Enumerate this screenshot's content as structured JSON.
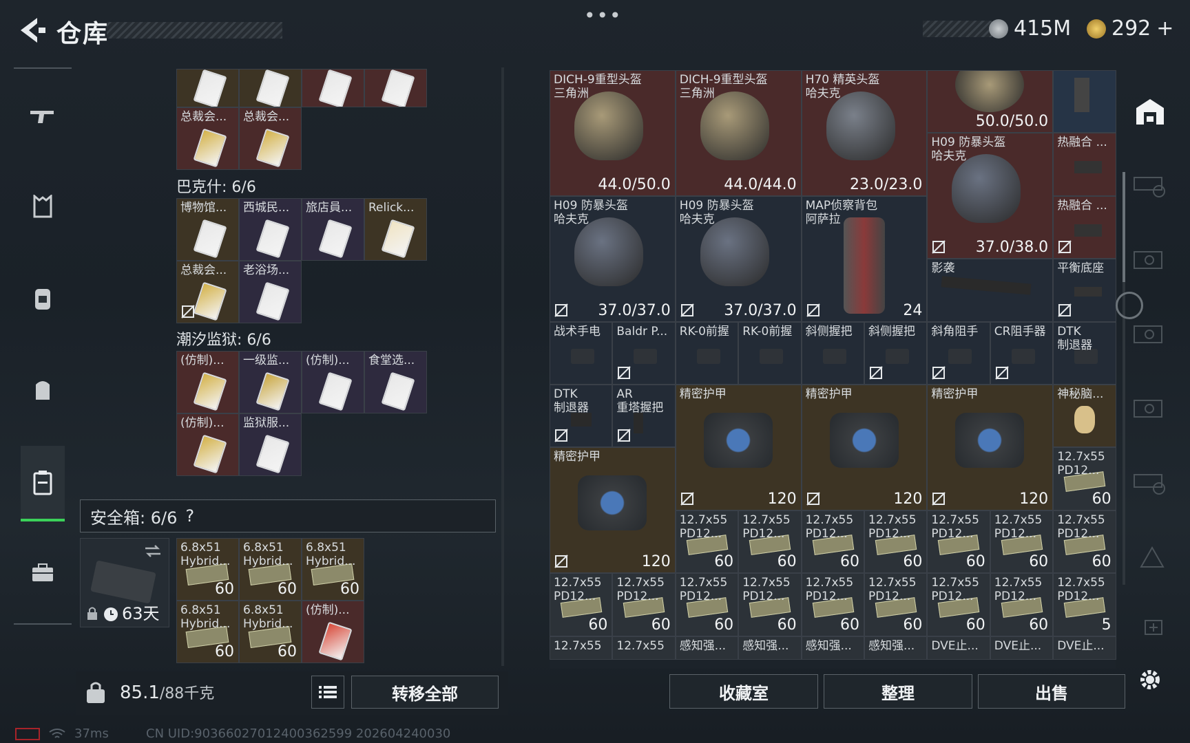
{
  "header": {
    "title": "仓库",
    "more": "•••",
    "currency_a": "415M",
    "currency_b": "292",
    "plus": "+"
  },
  "nav": [
    "weapon-icon",
    "armor-vest-icon",
    "backpack-icon",
    "chest-rig-icon",
    "container-icon",
    "briefcase-icon"
  ],
  "left": {
    "top_items": [
      {
        "label": "总裁会..."
      },
      {
        "label": "总裁会..."
      }
    ],
    "sections": [
      {
        "title": "巴克什: 6/6",
        "items": [
          {
            "label": "博物馆..."
          },
          {
            "label": "西城民..."
          },
          {
            "label": "旅店員..."
          },
          {
            "label": "Relick..."
          },
          {
            "label": "总裁会..."
          },
          {
            "label": "老浴场..."
          }
        ]
      },
      {
        "title": "潮汐监狱: 6/6",
        "items": [
          {
            "label": "(仿制)..."
          },
          {
            "label": "一级监..."
          },
          {
            "label": "(仿制)..."
          },
          {
            "label": "食堂选..."
          },
          {
            "label": "(仿制)..."
          },
          {
            "label": "监狱服..."
          }
        ]
      }
    ],
    "safe_title": "安全箱: 6/6",
    "safe_help": "?",
    "safe_days": "63天",
    "safe_items": [
      {
        "l1": "6.8x51",
        "l2": "Hybrid...",
        "val": "60"
      },
      {
        "l1": "6.8x51",
        "l2": "Hybrid...",
        "val": "60"
      },
      {
        "l1": "6.8x51",
        "l2": "Hybrid...",
        "val": "60"
      },
      {
        "l1": "6.8x51",
        "l2": "Hybrid...",
        "val": "60"
      },
      {
        "l1": "6.8x51",
        "l2": "Hybrid...",
        "val": "60"
      },
      {
        "l1": "(仿制)...",
        "l2": "",
        "val": ""
      }
    ],
    "capacity": "85.1",
    "capacity_max": "/88千克",
    "transfer_all": "转移全部"
  },
  "right": {
    "items": [
      {
        "l1": "DICH-9重型头盔",
        "l2": "三角洲",
        "val": "44.0/50.0"
      },
      {
        "l1": "DICH-9重型头盔",
        "l2": "三角洲",
        "val": "44.0/44.0"
      },
      {
        "l1": "H70 精英头盔",
        "l2": "哈夫克",
        "val": "23.0/23.0"
      },
      {
        "l1": "",
        "l2": "",
        "val": "50.0/50.0"
      },
      {
        "l1": "H09 防暴头盔",
        "l2": "哈夫克",
        "val": "37.0/38.0"
      },
      {
        "l1": "热融合 ...",
        "l2": "",
        "val": ""
      },
      {
        "l1": "热融合 ...",
        "l2": "",
        "val": ""
      },
      {
        "l1": "H09 防暴头盔",
        "l2": "哈夫克",
        "val": "37.0/37.0"
      },
      {
        "l1": "H09 防暴头盔",
        "l2": "哈夫克",
        "val": "37.0/37.0"
      },
      {
        "l1": "MAP侦察背包",
        "l2": "阿萨拉",
        "val": "24"
      },
      {
        "l1": "影袭",
        "l2": "",
        "val": ""
      },
      {
        "l1": "平衡底座",
        "l2": "",
        "val": ""
      },
      {
        "l1": "战术手电",
        "l2": "",
        "val": ""
      },
      {
        "l1": "Baldr P...",
        "l2": "",
        "val": ""
      },
      {
        "l1": "RK-0前握",
        "l2": "",
        "val": ""
      },
      {
        "l1": "RK-0前握",
        "l2": "",
        "val": ""
      },
      {
        "l1": "斜侧握把",
        "l2": "",
        "val": ""
      },
      {
        "l1": "斜侧握把",
        "l2": "",
        "val": ""
      },
      {
        "l1": "斜角阻手",
        "l2": "",
        "val": ""
      },
      {
        "l1": "CR阻手器",
        "l2": "",
        "val": ""
      },
      {
        "l1": "DTK",
        "l2": "制退器",
        "val": ""
      },
      {
        "l1": "DTK",
        "l2": "制退器",
        "val": ""
      },
      {
        "l1": "AR",
        "l2": "重塔握把",
        "val": ""
      },
      {
        "l1": "精密护甲",
        "l2": "",
        "val": "120"
      },
      {
        "l1": "精密护甲",
        "l2": "",
        "val": "120"
      },
      {
        "l1": "精密护甲",
        "l2": "",
        "val": "120"
      },
      {
        "l1": "神秘脑...",
        "l2": "",
        "val": ""
      },
      {
        "l1": "精密护甲",
        "l2": "",
        "val": "120"
      },
      {
        "l1": "12.7x55",
        "l2": "PD12...",
        "val": "60"
      },
      {
        "l1": "12.7x55",
        "l2": "PD12...",
        "val": "5"
      },
      {
        "l1": "感知强...",
        "l2": "",
        "val": ""
      },
      {
        "l1": "DVE止...",
        "l2": "",
        "val": ""
      }
    ],
    "ammo_label": "12.7x55",
    "ammo_sub": "PD12...",
    "ammo_val": "60",
    "btn_collection": "收藏室",
    "btn_sort": "整理",
    "btn_sell": "出售"
  },
  "footer": {
    "ping": "37ms",
    "uid": "CN UID:9036602701240036259​9 202604240030"
  }
}
